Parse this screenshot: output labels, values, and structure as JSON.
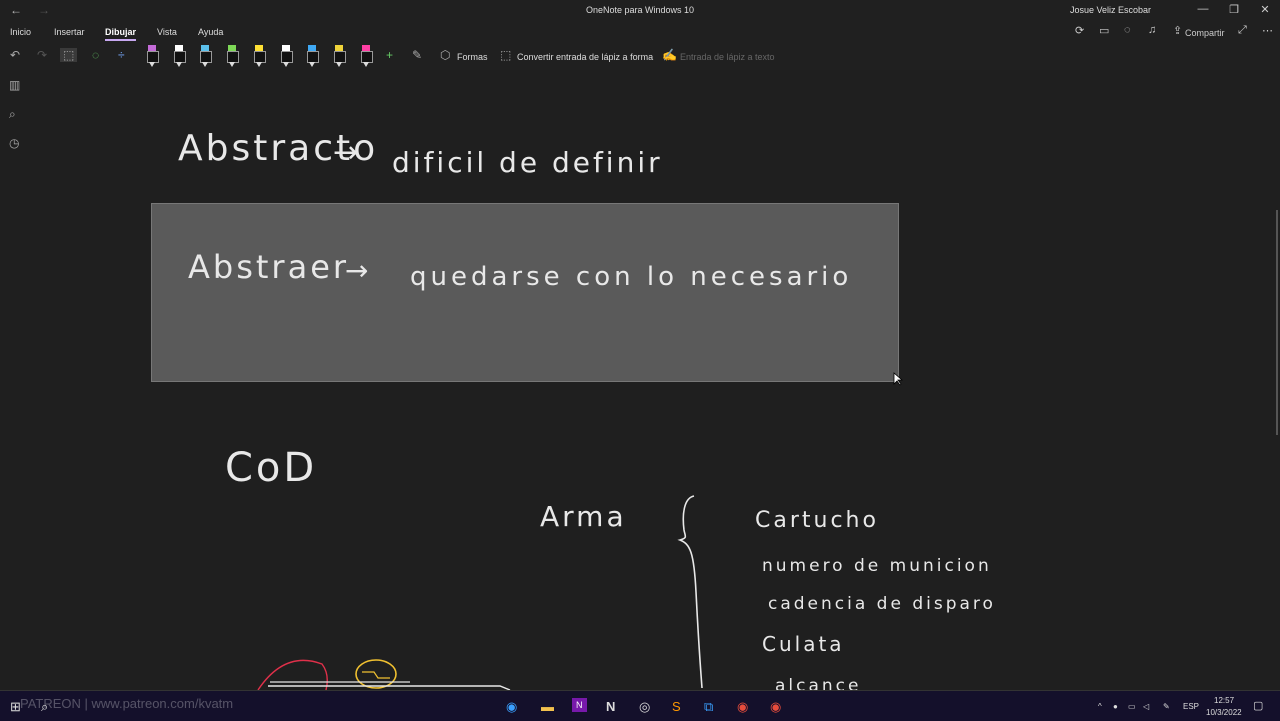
{
  "titlebar": {
    "back": "←",
    "forward": "→",
    "title": "OneNote para Windows 10",
    "user": "Josue Veliz Escobar",
    "minimize": "—",
    "restore": "❐",
    "close": "✕"
  },
  "menubar": {
    "items": [
      {
        "label": "Inicio"
      },
      {
        "label": "Insertar"
      },
      {
        "label": "Dibujar"
      },
      {
        "label": "Vista"
      },
      {
        "label": "Ayuda"
      }
    ],
    "share_label": "Compartir"
  },
  "ribbon": {
    "shapes_label": "Formas",
    "convert_label": "Convertir entrada de lápiz a forma",
    "ink_to_text_label": "Entrada de lápiz a texto",
    "pen_colors": [
      "#c46bd8",
      "#ffffff",
      "#5bc0eb",
      "#7ed957",
      "#ffe135",
      "#ffffff",
      "#3fa9f5",
      "#f0d43a",
      "#ff3fa4"
    ]
  },
  "ink": {
    "line1_left": "Abstracto",
    "line1_arrow": "→",
    "line1_right": "dificil de definir",
    "box_left": "Abstraer",
    "box_arrow": "→",
    "box_right": "quedarse con lo necesario",
    "cod": "CoD",
    "arma": "Arma",
    "brace": "{",
    "list": [
      "Cartucho",
      "numero de municion",
      "cadencia de disparo",
      "Culata",
      "alcance"
    ]
  },
  "watermark": "PATREON | www.patreon.com/kvatm",
  "taskbar": {
    "lang": "ESP",
    "time": "12:57",
    "date": "10/3/2022"
  }
}
